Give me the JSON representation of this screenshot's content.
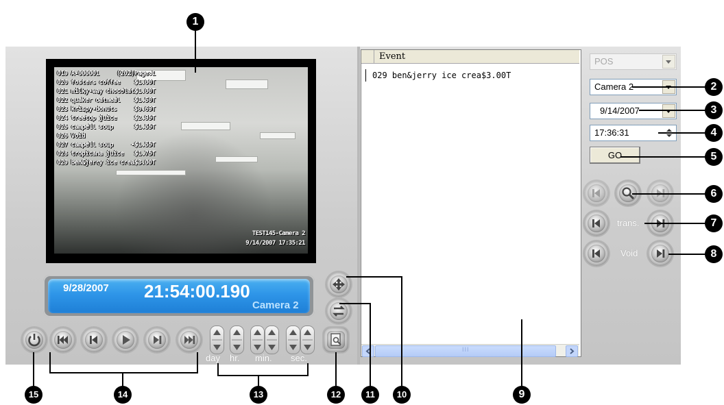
{
  "video": {
    "pos_lines": [
      "019 A-000001     (202)Page:1",
      "020 fosters coffee    $1.00T",
      "021 milky-way chocolat$1.00T",
      "022 quaker oatmeal    $1.50T",
      "023 krispy-donuts     $0.69T",
      "024 treetop juice     $2.95T",
      "025 campell soup      $1.55T",
      "026 Void",
      "027 campell soup     -$1.55T",
      "028 tropicana juice   $1.75T",
      "029 ben&jerry ice crea$3.00T"
    ],
    "osd_camera": "TEST145-Camera 2",
    "osd_datetime": "9/14/2007 17:35:21"
  },
  "status": {
    "date": "9/28/2007",
    "time": "21:54:00.190",
    "camera": "Camera 2"
  },
  "stepper_labels": {
    "day": "day",
    "hr": "hr.",
    "min": "min.",
    "sec": "sec."
  },
  "events": {
    "header": "Event",
    "rows": [
      "029 ben&jerry ice crea$3.00T"
    ],
    "scroll_thumb_glyph": "III"
  },
  "controls": {
    "pos_select": "POS",
    "camera_select": "Camera 2",
    "date_select": "9/14/2007",
    "time_spin": "17:36:31",
    "go_label": "GO",
    "trans_label": "trans.",
    "void_label": "Void"
  },
  "callouts": {
    "c1": "1",
    "c2": "2",
    "c3": "3",
    "c4": "4",
    "c5": "5",
    "c6": "6",
    "c7": "7",
    "c8": "8",
    "c9": "9",
    "c10": "10",
    "c11": "11",
    "c12": "12",
    "c13": "13",
    "c14": "14",
    "c15": "15"
  },
  "colors": {
    "status_blue": "#2e95e8",
    "panel_gray": "#cdcdcd",
    "callout_black": "#000000"
  }
}
